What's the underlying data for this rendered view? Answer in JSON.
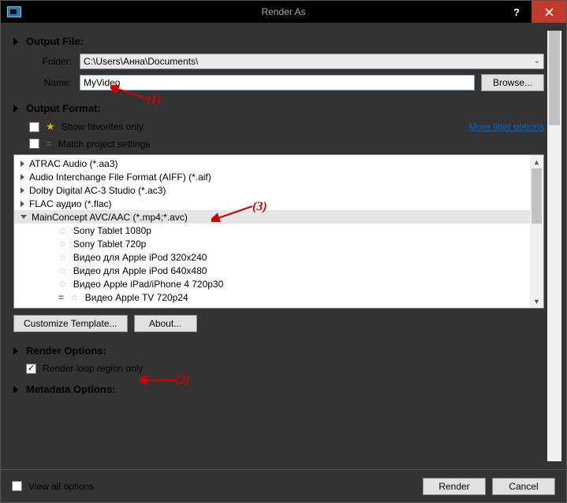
{
  "window": {
    "title": "Render As"
  },
  "sections": {
    "outputFile": "Output File:",
    "outputFormat": "Output Format:",
    "renderOptions": "Render Options:",
    "metadataOptions": "Metadata Options:"
  },
  "outputFile": {
    "folderLabel": "Folder:",
    "folderValue": "C:\\Users\\Анна\\Documents\\",
    "nameLabel": "Name:",
    "nameValue": "MyVideo",
    "browse": "Browse..."
  },
  "outputFormat": {
    "showFavorites": "Show favorites only",
    "matchProject": "Match project settings",
    "moreFilter": "More filter options",
    "items": [
      "ATRAC Audio (*.aa3)",
      "Audio Interchange File Format (AIFF) (*.aif)",
      "Dolby Digital AC-3 Studio (*.ac3)",
      "FLAC аудио (*.flac)",
      "MainConcept AVC/AAC (*.mp4;*.avc)"
    ],
    "subItems": [
      "Sony Tablet 1080p",
      "Sony Tablet 720p",
      "Видео для Apple iPod 320x240",
      "Видео для Apple iPod 640x480",
      "Видео Apple iPad/iPhone 4 720p30",
      "Видео Apple TV 720p24"
    ],
    "customize": "Customize Template...",
    "about": "About..."
  },
  "renderOptions": {
    "loopRegion": "Render loop region only"
  },
  "footer": {
    "viewAll": "View all options",
    "render": "Render",
    "cancel": "Cancel"
  },
  "annotations": {
    "a1": "(1)",
    "a2": "(2)",
    "a3": "(3)"
  }
}
